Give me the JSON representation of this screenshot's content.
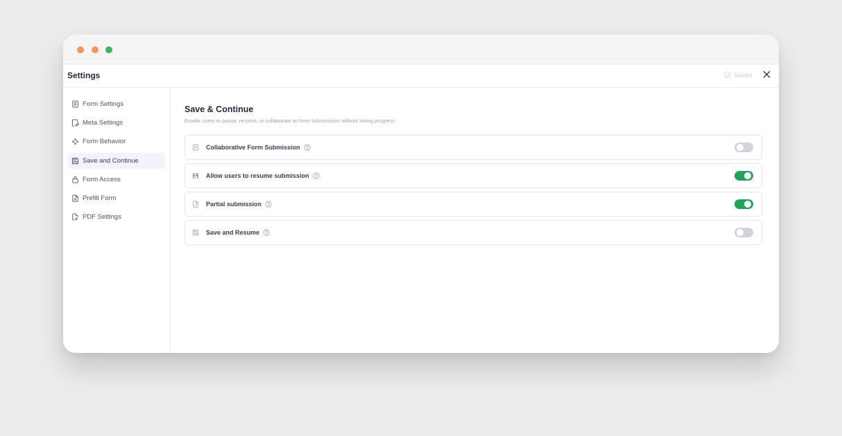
{
  "window": {
    "traffic_lights": [
      "#ef9a5b",
      "#ef9a5b",
      "#3fb563"
    ]
  },
  "header": {
    "title": "Settings",
    "saved_label": "Saved"
  },
  "sidebar": {
    "items": [
      {
        "label": "Form Settings",
        "icon": "document-icon",
        "active": false
      },
      {
        "label": "Meta Settings",
        "icon": "edit-doc-icon",
        "active": false
      },
      {
        "label": "Form Behavior",
        "icon": "sparkle-icon",
        "active": false
      },
      {
        "label": "Save and Continue",
        "icon": "save-icon",
        "active": true
      },
      {
        "label": "Form Access",
        "icon": "lock-icon",
        "active": false
      },
      {
        "label": "Prefill Form",
        "icon": "file-text-icon",
        "active": false
      },
      {
        "label": "PDF Settings",
        "icon": "pdf-file-icon",
        "active": false
      }
    ]
  },
  "main": {
    "title": "Save & Continue",
    "description": "Enable users to pause, resume, or collaborate on form submissions without losing progress",
    "rows": [
      {
        "label": "Collaborative Form Submission",
        "icon": "document-icon",
        "enabled": false
      },
      {
        "label": "Allow users to resume submission",
        "icon": "save-icon",
        "enabled": true
      },
      {
        "label": "Partial submission",
        "icon": "file-check-icon",
        "enabled": true
      },
      {
        "label": "Save and Resume",
        "icon": "save-outline-icon",
        "enabled": false
      }
    ]
  },
  "colors": {
    "toggle_on": "#22a35a",
    "toggle_off": "#d1d5db",
    "active_nav_bg": "#f4f2ff"
  }
}
